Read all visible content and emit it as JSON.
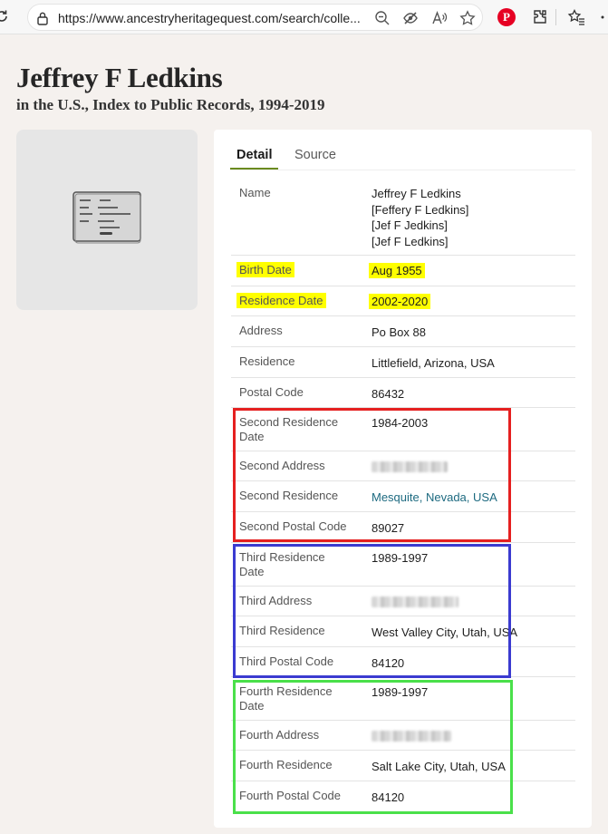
{
  "browser": {
    "url": "https://www.ancestryheritagequest.com/search/colle..."
  },
  "header": {
    "name": "Jeffrey F Ledkins",
    "collection": "in the U.S., Index to Public Records, 1994-2019"
  },
  "tabs": [
    {
      "label": "Detail",
      "active": true
    },
    {
      "label": "Source",
      "active": false
    }
  ],
  "rows": {
    "name": {
      "label": "Name",
      "values": [
        "Jeffrey F Ledkins",
        "[Feffery F Ledkins]",
        "[Jef F Jedkins]",
        "[Jef F Ledkins]"
      ]
    },
    "birth_date": {
      "label": "Birth Date",
      "value": "Aug 1955",
      "highlight": "#ffff00"
    },
    "residence_date": {
      "label": "Residence Date",
      "value": "2002-2020",
      "highlight": "#ffff00"
    },
    "address": {
      "label": "Address",
      "value": "Po Box 88"
    },
    "residence": {
      "label": "Residence",
      "value": "Littlefield, Arizona, USA"
    },
    "postal_code": {
      "label": "Postal Code",
      "value": "86432"
    },
    "second_residence_date": {
      "label": "Second Residence Date",
      "value": "1984-2003"
    },
    "second_address": {
      "label": "Second Address",
      "value_blurred": true
    },
    "second_residence": {
      "label": "Second Residence",
      "value": "Mesquite, Nevada, USA"
    },
    "second_postal_code": {
      "label": "Second Postal Code",
      "value": "89027"
    },
    "third_residence_date": {
      "label": "Third Residence Date",
      "value": "1989-1997"
    },
    "third_address": {
      "label": "Third Address",
      "value_blurred": true
    },
    "third_residence": {
      "label": "Third Residence",
      "value": "West Valley City, Utah, USA"
    },
    "third_postal_code": {
      "label": "Third Postal Code",
      "value": "84120"
    },
    "fourth_residence_date": {
      "label": "Fourth Residence Date",
      "value": "1989-1997"
    },
    "fourth_address": {
      "label": "Fourth Address",
      "value_blurred": true
    },
    "fourth_residence": {
      "label": "Fourth Residence",
      "value": "Salt Lake City, Utah, USA"
    },
    "fourth_postal_code": {
      "label": "Fourth Postal Code",
      "value": "84120"
    }
  },
  "colors": {
    "highlight": "#ffff00",
    "box_second": "#e52020",
    "box_third": "#3b3bd0",
    "box_fourth": "#4ae04a",
    "link": "#1d6a80",
    "tab_accent": "#6a8a1f"
  },
  "icons": [
    "reload-icon",
    "lock-icon",
    "zoom-out-icon",
    "tracking-prevention-icon",
    "read-aloud-icon",
    "favorite-star-icon",
    "pinterest-icon",
    "extensions-icon",
    "favorites-icon",
    "record-document-icon"
  ]
}
